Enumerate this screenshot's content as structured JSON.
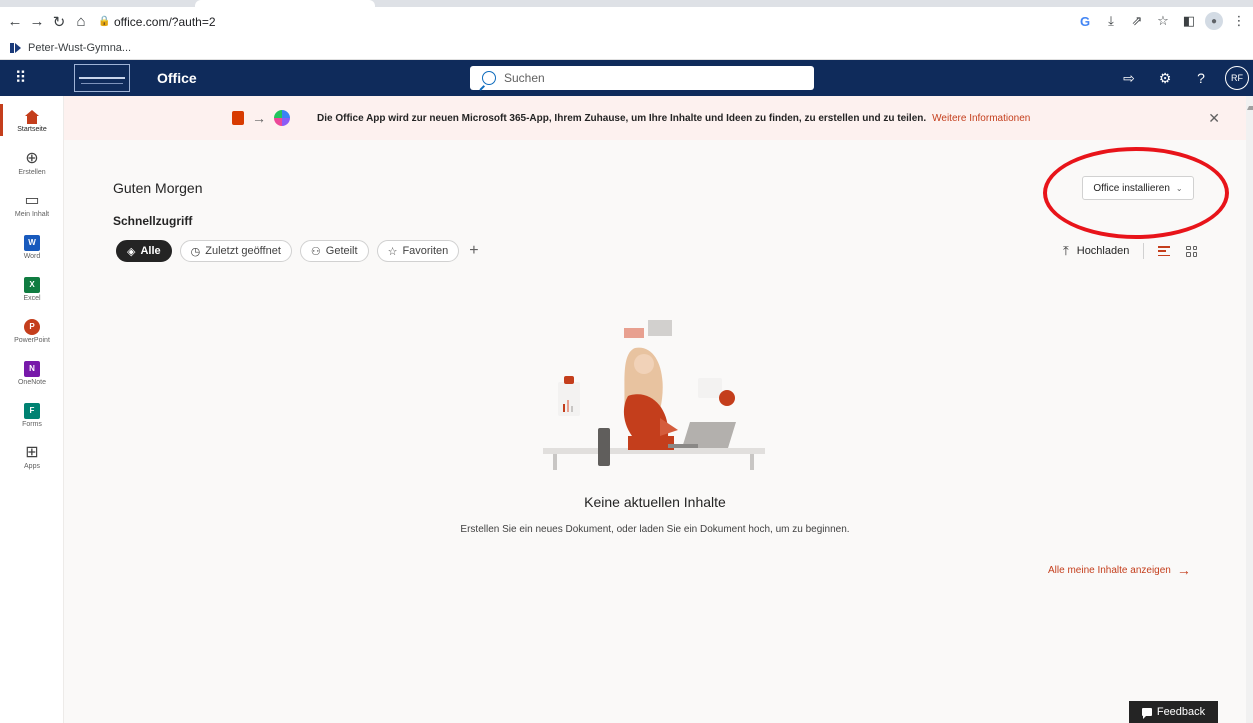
{
  "browser": {
    "url": "office.com/?auth=2",
    "bookmark_label": "Peter-Wust-Gymna..."
  },
  "header": {
    "app_name": "Office",
    "search_placeholder": "Suchen",
    "avatar_initials": "RF"
  },
  "rail": {
    "items": [
      {
        "label": "Startseite",
        "icon": "home-icon"
      },
      {
        "label": "Erstellen",
        "icon": "add-circle-icon"
      },
      {
        "label": "Mein Inhalt",
        "icon": "folder-icon"
      },
      {
        "label": "Word",
        "icon": "word-icon",
        "letter": "W",
        "color": "#185abd"
      },
      {
        "label": "Excel",
        "icon": "excel-icon",
        "letter": "X",
        "color": "#107c41"
      },
      {
        "label": "PowerPoint",
        "icon": "powerpoint-icon",
        "letter": "P",
        "color": "#c43e1c"
      },
      {
        "label": "OneNote",
        "icon": "onenote-icon",
        "letter": "N",
        "color": "#7719aa"
      },
      {
        "label": "Forms",
        "icon": "forms-icon",
        "letter": "F",
        "color": "#008272"
      },
      {
        "label": "Apps",
        "icon": "apps-icon"
      }
    ]
  },
  "banner": {
    "text": "Die Office App wird zur neuen Microsoft 365-App, Ihrem Zuhause, um Ihre Inhalte und Ideen zu finden, zu erstellen und zu teilen.",
    "link": "Weitere Informationen"
  },
  "main": {
    "greeting": "Guten Morgen",
    "quick_access": "Schnellzugriff",
    "filters": [
      "Alle",
      "Zuletzt geöffnet",
      "Geteilt",
      "Favoriten"
    ],
    "install_label": "Office installieren",
    "upload_label": "Hochladen",
    "empty_title": "Keine aktuellen Inhalte",
    "empty_desc": "Erstellen Sie ein neues Dokument, oder laden Sie ein Dokument hoch, um zu beginnen.",
    "see_all": "Alle meine Inhalte anzeigen",
    "feedback": "Feedback"
  },
  "colors": {
    "header_bg": "#0f2b5b",
    "accent": "#c43e1c",
    "annotation": "#e8141a"
  }
}
